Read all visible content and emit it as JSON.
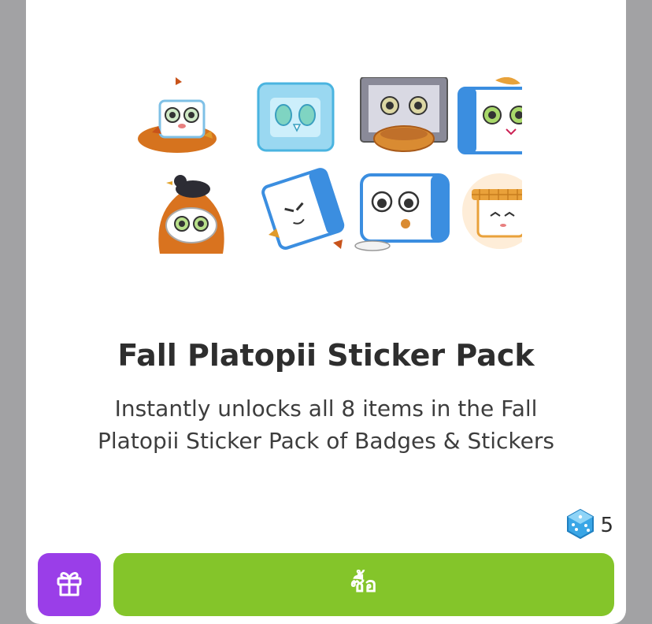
{
  "product": {
    "title": "Fall Platopii Sticker Pack",
    "description_line1": "Instantly unlocks all 8 items in the Fall",
    "description_line2": "Platopii Sticker Pack of Badges & Stickers"
  },
  "stickers": [
    {
      "name": "leaf-pile-sticker"
    },
    {
      "name": "ice-cube-sticker"
    },
    {
      "name": "oven-pie-sticker"
    },
    {
      "name": "leaf-hat-sticker"
    },
    {
      "name": "crow-leaf-pile-sticker"
    },
    {
      "name": "tumbling-sticker"
    },
    {
      "name": "eating-sticker"
    },
    {
      "name": "scarf-glow-sticker"
    }
  ],
  "price": {
    "value": "5",
    "currency_icon": "gem-dice-icon"
  },
  "actions": {
    "gift_icon": "gift-icon",
    "buy_label": "ซื้อ"
  },
  "colors": {
    "backdrop": "#a2a2a4",
    "gift_button": "#9a3ee8",
    "buy_button": "#84c52a",
    "gem": "#3aa6e6"
  }
}
